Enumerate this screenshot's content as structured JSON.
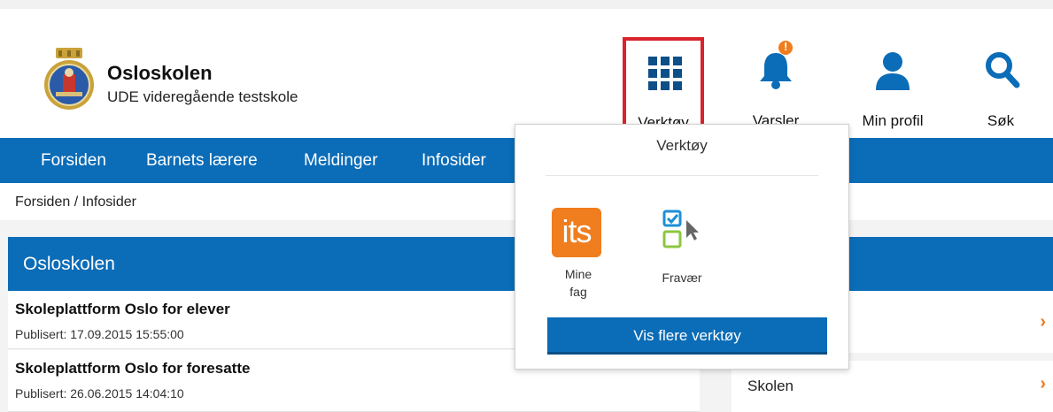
{
  "header": {
    "school_name": "Osloskolen",
    "school_sub": "UDE videregående testskole",
    "buttons": {
      "tools": "Verktøy",
      "notifications": "Varsler",
      "profile": "Min profil",
      "search": "Søk"
    },
    "notification_badge": "!"
  },
  "nav": {
    "items": [
      "Forsiden",
      "Barnets lærere",
      "Meldinger",
      "Infosider"
    ]
  },
  "breadcrumb": "Forsiden / Infosider",
  "panel": {
    "title": "Osloskolen",
    "articles": [
      {
        "title": "Skoleplattform Oslo for elever",
        "date": "Publisert: 17.09.2015 15:55:00"
      },
      {
        "title": "Skoleplattform Oslo for foresatte",
        "date": "Publisert: 26.06.2015 14:04:10"
      }
    ]
  },
  "right_panel": {
    "rows": [
      "",
      "Skolen"
    ]
  },
  "dropdown": {
    "title": "Verktøy",
    "tools": [
      {
        "label_line1": "Mine",
        "label_line2": "fag",
        "icon_text": "its"
      },
      {
        "label_line1": "Fravær"
      }
    ],
    "more_button": "Vis flere verktøy"
  },
  "colors": {
    "brand_blue": "#0b6cb7",
    "accent_orange": "#e87722",
    "highlight_red": "#d9232d"
  },
  "icons": [
    "grid-icon",
    "bell-icon",
    "person-icon",
    "search-icon",
    "chevron-right-icon",
    "its-logo-icon",
    "checkbox-cursor-icon",
    "oslo-seal-logo"
  ]
}
